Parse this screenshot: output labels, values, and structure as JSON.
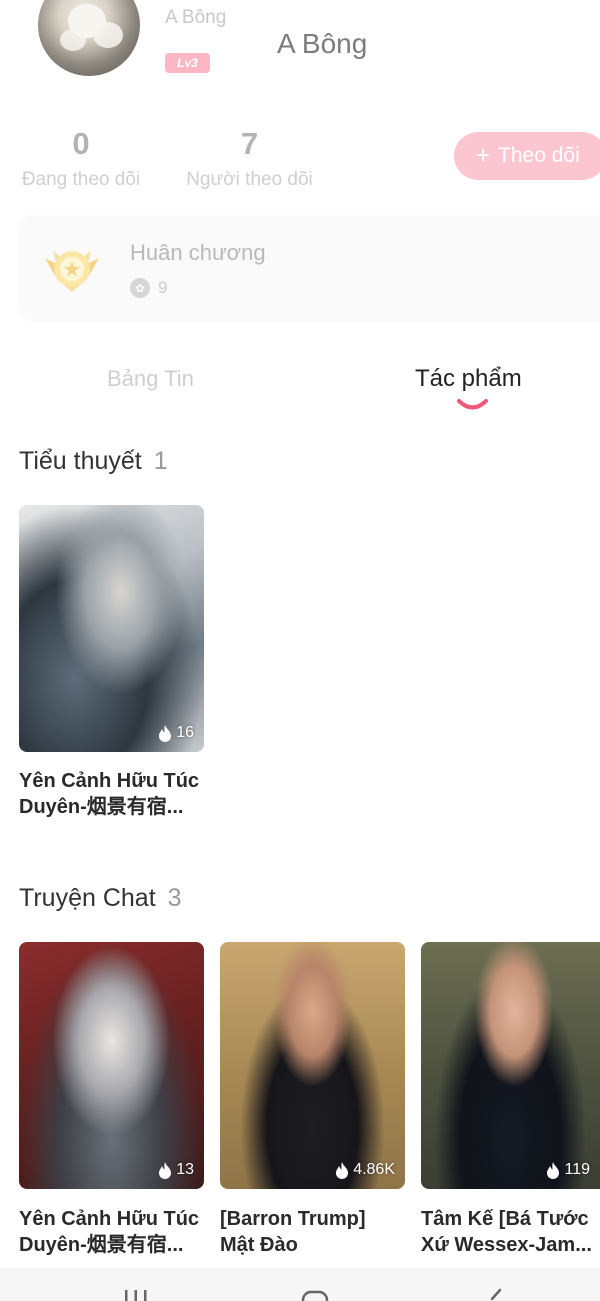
{
  "profile": {
    "small_name": "A Bông",
    "level": "Lv3",
    "name": "A Bông"
  },
  "stats": {
    "following_count": "0",
    "following_label": "Đang theo dõi",
    "followers_count": "7",
    "followers_label": "Người theo dõi",
    "follow_button": "Theo dõi"
  },
  "medals": {
    "title": "Huân chương",
    "count": "9"
  },
  "tabs": {
    "feed": "Bảng Tin",
    "works": "Tác phẩm",
    "active": "works"
  },
  "novels": {
    "title": "Tiểu thuyết",
    "count": "1",
    "items": [
      {
        "title": "Yên Cảnh Hữu Túc Duyên-烟景有宿...",
        "views": "16"
      }
    ]
  },
  "chat_stories": {
    "title": "Truyện Chat",
    "count": "3",
    "items": [
      {
        "title": "Yên Cảnh Hữu Túc Duyên-烟景有宿...",
        "views": "13"
      },
      {
        "title": "[Barron Trump] Mật Đào",
        "views": "4.86K"
      },
      {
        "title": "Tâm Kế [Bá Tước Xứ Wessex-Jam...",
        "views": "119"
      }
    ]
  },
  "colors": {
    "accent_pink": "#f0587a",
    "button_pink": "#fcc6d0"
  }
}
